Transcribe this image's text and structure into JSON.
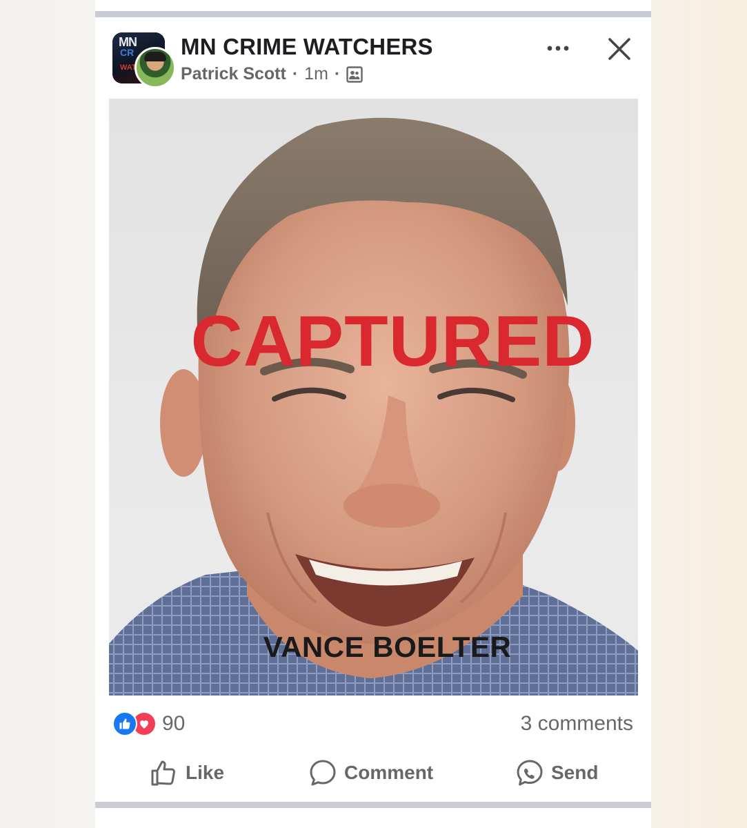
{
  "post": {
    "group_name": "MN CRIME WATCHERS",
    "author": "Patrick Scott",
    "time": "1m",
    "separator": "·",
    "audience_icon": "group-members-icon",
    "avatar_logo": {
      "line1": "MN",
      "line2": "CR",
      "line3": "WAT"
    },
    "image": {
      "overlay_title": "CAPTURED",
      "overlay_name": "VANCE BOELTER"
    },
    "reactions": {
      "types": [
        "like",
        "love"
      ],
      "count": "90"
    },
    "comments_label": "3 comments",
    "actions": {
      "like_label": "Like",
      "comment_label": "Comment",
      "send_label": "Send"
    },
    "icons": {
      "more": "more-options-icon",
      "close": "close-icon",
      "like": "thumbs-up-icon",
      "comment": "comment-bubble-icon",
      "send": "messenger-icon"
    }
  },
  "colors": {
    "captured_red": "#d9282f",
    "like_blue": "#1877f2",
    "love_red": "#f33e58",
    "meta_gray": "#65676b",
    "divider": "#c9ccd6"
  }
}
